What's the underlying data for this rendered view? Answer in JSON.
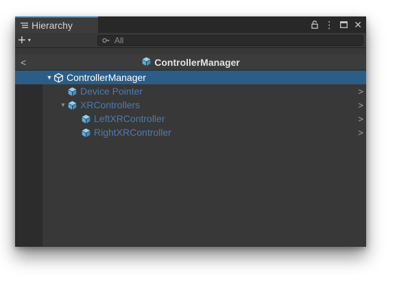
{
  "window": {
    "tab_title": "Hierarchy",
    "controls": {
      "lock": "lock-icon",
      "more": "⋮",
      "maximize": "maximize-icon",
      "close": "✕"
    }
  },
  "toolbar": {
    "add_label": "+",
    "add_dropdown": "▾",
    "search_placeholder": "All"
  },
  "scene": {
    "back_label": "<",
    "title": "ControllerManager"
  },
  "colors": {
    "accent": "#3a79bb",
    "selection": "#2c5d87",
    "prefab_text": "#4d7ab3",
    "prefab_icon": "#5aaee0"
  },
  "tree": {
    "items": [
      {
        "label": "ControllerManager",
        "depth": 0,
        "expanded": true,
        "has_children": true,
        "selected": true,
        "prefab": false,
        "has_chevron": false
      },
      {
        "label": "Device Pointer",
        "depth": 1,
        "expanded": false,
        "has_children": false,
        "selected": false,
        "prefab": true,
        "has_chevron": true
      },
      {
        "label": "XRControllers",
        "depth": 1,
        "expanded": true,
        "has_children": true,
        "selected": false,
        "prefab": true,
        "has_chevron": true
      },
      {
        "label": "LeftXRController",
        "depth": 2,
        "expanded": false,
        "has_children": false,
        "selected": false,
        "prefab": true,
        "has_chevron": true
      },
      {
        "label": "RightXRController",
        "depth": 2,
        "expanded": false,
        "has_children": false,
        "selected": false,
        "prefab": true,
        "has_chevron": true
      }
    ]
  }
}
